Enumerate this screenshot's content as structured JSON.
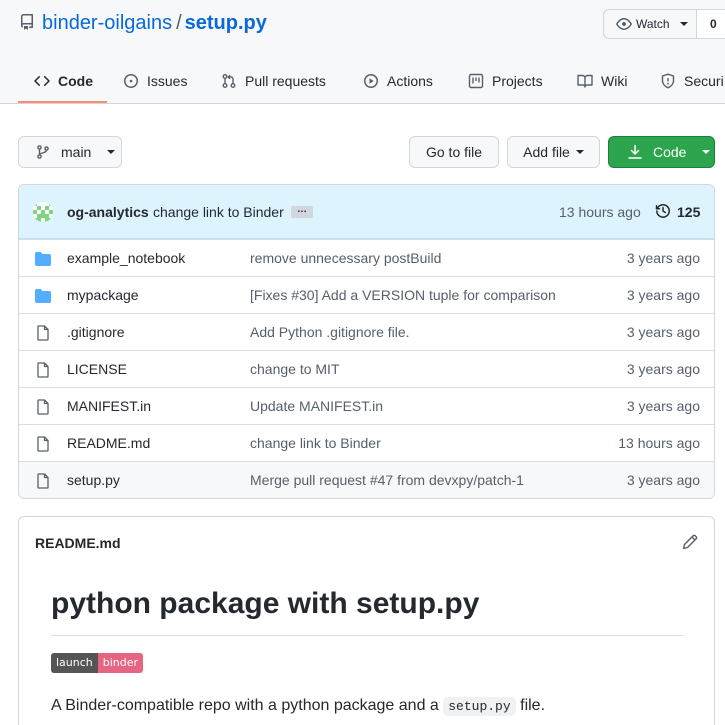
{
  "repo": {
    "owner": "binder-oilgains",
    "separator": "/",
    "file": "setup.py"
  },
  "watch": {
    "label": "Watch",
    "count": "0"
  },
  "tabs": [
    {
      "label": "Code",
      "icon": "code-icon",
      "active": true
    },
    {
      "label": "Issues",
      "icon": "issue-icon"
    },
    {
      "label": "Pull requests",
      "icon": "pull-request-icon"
    },
    {
      "label": "Actions",
      "icon": "play-icon"
    },
    {
      "label": "Projects",
      "icon": "project-icon"
    },
    {
      "label": "Wiki",
      "icon": "book-icon"
    },
    {
      "label": "Securi",
      "icon": "shield-icon"
    }
  ],
  "toolbar": {
    "branch": "main",
    "goto_file": "Go to file",
    "add_file": "Add file",
    "code": "Code"
  },
  "latest_commit": {
    "author": "og-analytics",
    "message": "change link to Binder",
    "ellipsis": "…",
    "time": "13 hours ago",
    "count": "125"
  },
  "files": [
    {
      "name": "example_notebook",
      "type": "folder",
      "message": "remove unnecessary postBuild",
      "time": "3 years ago"
    },
    {
      "name": "mypackage",
      "type": "folder",
      "message": "[Fixes #30] Add a VERSION tuple for comparison",
      "time": "3 years ago"
    },
    {
      "name": ".gitignore",
      "type": "file",
      "message": "Add Python .gitignore file.",
      "time": "3 years ago"
    },
    {
      "name": "LICENSE",
      "type": "file",
      "message": "change to MIT",
      "time": "3 years ago"
    },
    {
      "name": "MANIFEST.in",
      "type": "file",
      "message": "Update MANIFEST.in",
      "time": "3 years ago"
    },
    {
      "name": "README.md",
      "type": "file",
      "message": "change link to Binder",
      "time": "13 hours ago"
    },
    {
      "name": "setup.py",
      "type": "file",
      "message": "Merge pull request #47 from devxpy/patch-1",
      "time": "3 years ago",
      "highlighted": true
    }
  ],
  "readme": {
    "title": "README.md",
    "heading": "python package with setup.py",
    "badge_left": "launch",
    "badge_right": "binder",
    "paragraph_before": "A Binder-compatible repo with a python package and a ",
    "paragraph_code": "setup.py",
    "paragraph_after": " file."
  },
  "colors": {
    "link": "#0969da",
    "primary_button": "#2da44e",
    "active_tab_underline": "#fd8c73",
    "commit_bar": "#ddf4ff",
    "folder": "#54aeff",
    "badge_right": "#e66581"
  }
}
